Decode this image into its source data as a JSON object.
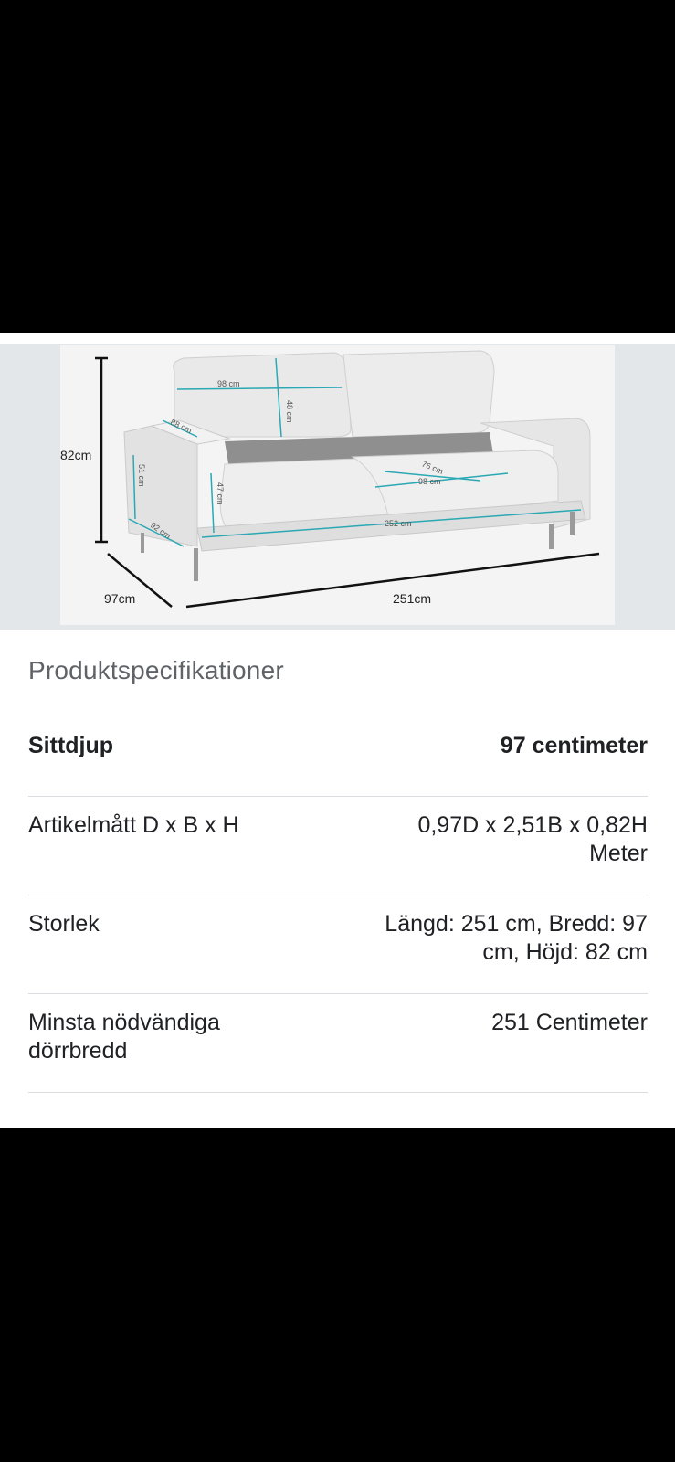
{
  "image": {
    "alt_icon": "sofa-dimensions-image",
    "labels": {
      "height": "82cm",
      "depth": "97cm",
      "width": "251cm",
      "cushion_width": "98 cm",
      "cushion_height": "48 cm",
      "armrest_depth": "88 cm",
      "arm_height": "51 cm",
      "seat_height": "47 cm",
      "arm_depth": "92 cm",
      "seat_inner_depth": "76 cm",
      "seat_inner_width": "98 cm",
      "seat_total_width": "252 cm"
    }
  },
  "specs": {
    "title": "Produktspecifikationer",
    "rows": [
      {
        "label": "Sittdjup",
        "value": "97 centimeter"
      },
      {
        "label": "Artikelmått D x B x H",
        "value": "0,97D x 2,51B x 0,82H Meter"
      },
      {
        "label": "Storlek",
        "value": "Längd: 251 cm, Bredd: 97 cm, Höjd: 82 cm"
      },
      {
        "label": "Minsta nödvändiga dörrbredd",
        "value": "251 Centimeter"
      }
    ]
  },
  "colors": {
    "dimension_line": "#2aa8b3",
    "title_text": "#5f6368",
    "body_text": "#202124",
    "divider": "#dadce0"
  }
}
